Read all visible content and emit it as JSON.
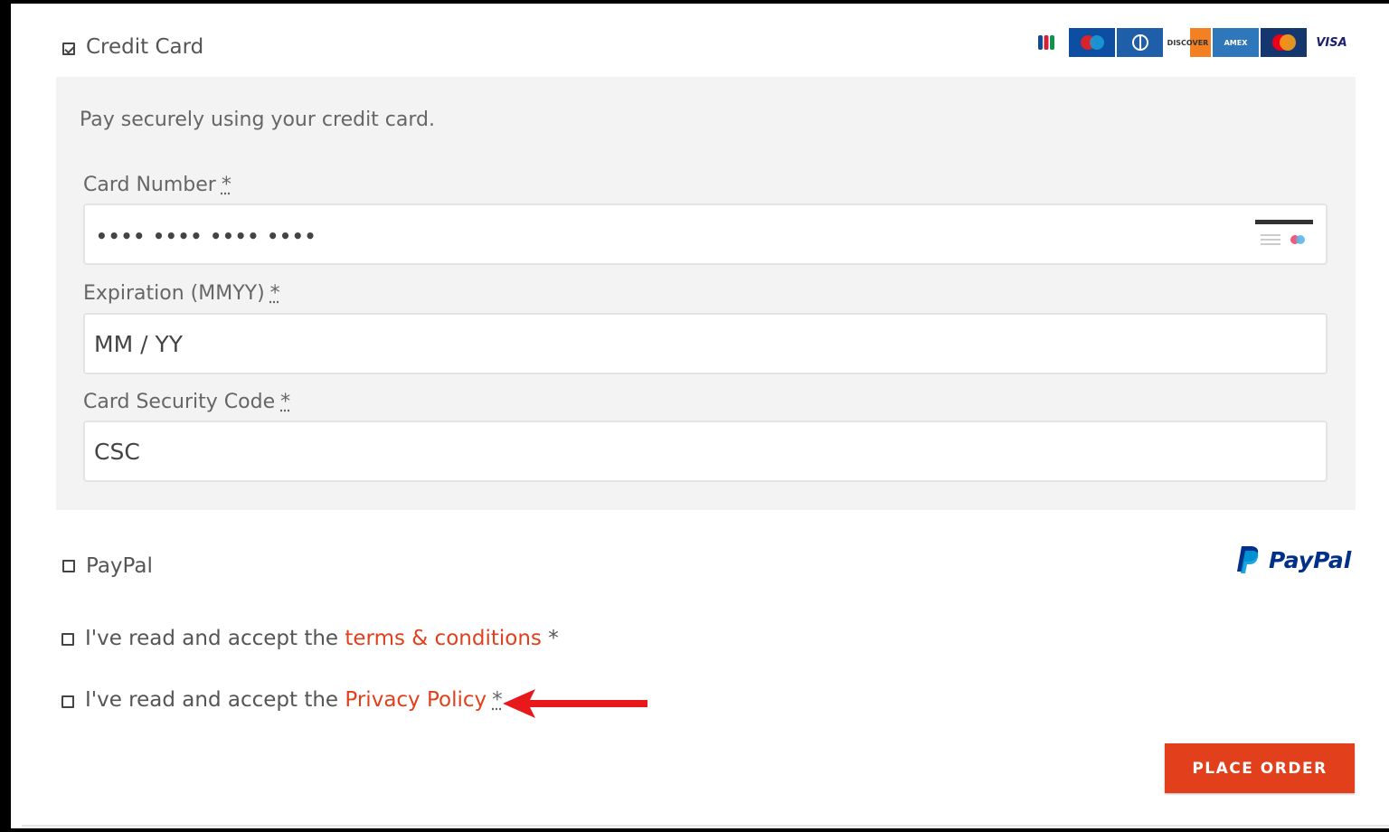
{
  "payment": {
    "credit_card": {
      "label": "Credit Card",
      "checked": true,
      "description": "Pay securely using your credit card.",
      "card_brands": [
        "JCB",
        "Maestro",
        "Diners Club",
        "Discover",
        "American Express",
        "Mastercard",
        "VISA"
      ],
      "fields": {
        "card_number": {
          "label": "Card Number",
          "required_marker": "*",
          "placeholder": "•••• •••• •••• ••••"
        },
        "expiration": {
          "label": "Expiration (MMYY)",
          "required_marker": "*",
          "placeholder": "MM / YY"
        },
        "security_code": {
          "label": "Card Security Code",
          "required_marker": "*",
          "placeholder": "CSC"
        }
      }
    },
    "paypal": {
      "label": "PayPal",
      "checked": false,
      "logo_text": "PayPal"
    }
  },
  "agreements": {
    "terms": {
      "prefix": "I've read and accept the ",
      "link": "terms & conditions",
      "required_marker": " *"
    },
    "privacy": {
      "prefix": "I've read and accept the ",
      "link": "Privacy Policy",
      "required_marker": "*"
    }
  },
  "place_order_label": "PLACE ORDER",
  "colors": {
    "accent": "#e2401c",
    "annotation_arrow": "#e8191b",
    "paypal_dark": "#003087",
    "paypal_light": "#009cde",
    "method_box_bg": "#f3f3f3"
  },
  "icons": [
    "checkbox-checked-icon",
    "checkbox-icon",
    "card-icon",
    "paypal-icon",
    "arrow-left-icon"
  ]
}
